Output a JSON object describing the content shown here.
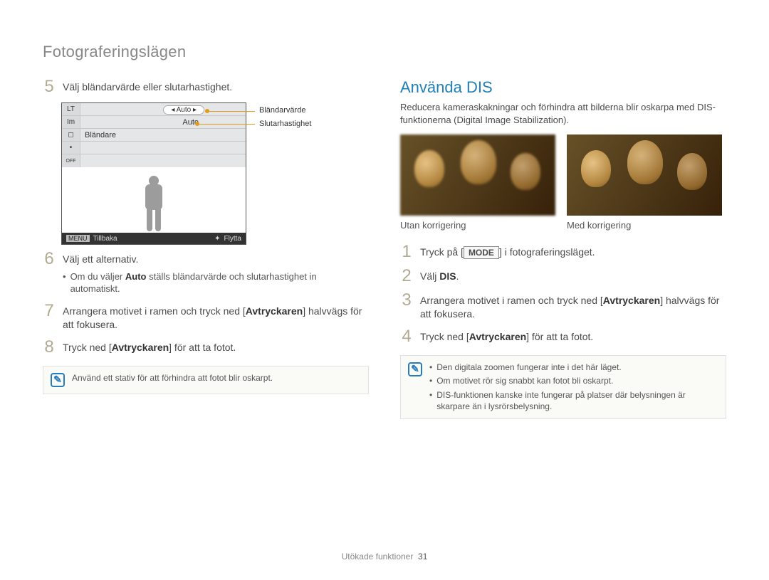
{
  "section_title": "Fotograferingslägen",
  "left": {
    "step5": {
      "num": "5",
      "text": "Välj bländarvärde eller slutarhastighet."
    },
    "lcd": {
      "row1_icon": "LT",
      "row1_value": "Auto",
      "row2_icon": "Im",
      "row2_value": "Auto",
      "row3_icon": "◻",
      "row3_label": "Bländare",
      "row4_icon": "•",
      "row5_icon": "OFF",
      "footer_menu": "MENU",
      "footer_back": "Tillbaka",
      "footer_move": "Flytta"
    },
    "annot1": "Bländarvärde",
    "annot2": "Slutarhastighet",
    "step6": {
      "num": "6",
      "text": "Välj ett alternativ.",
      "sub_prefix": "Om du väljer ",
      "sub_bold": "Auto",
      "sub_suffix": " ställs bländarvärde och slutarhastighet in automatiskt."
    },
    "step7": {
      "num": "7",
      "pre": "Arrangera motivet i ramen och tryck ned [",
      "bold": "Avtryckaren",
      "post": "] halvvägs för att fokusera."
    },
    "step8": {
      "num": "8",
      "pre": "Tryck ned [",
      "bold": "Avtryckaren",
      "post": "] för att ta fotot."
    },
    "tip": "Använd ett stativ för att förhindra att fotot blir oskarpt."
  },
  "right": {
    "title": "Använda DIS",
    "desc": "Reducera kameraskakningar och förhindra att bilderna blir oskarpa med DIS-funktionerna (Digital Image Stabilization).",
    "caption_a": "Utan korrigering",
    "caption_b": "Med korrigering",
    "step1": {
      "num": "1",
      "pre": "Tryck på [",
      "key": "MODE",
      "post": "] i fotograferingsläget."
    },
    "step2": {
      "num": "2",
      "pre": "Välj ",
      "bold": "DIS",
      "post": "."
    },
    "step3": {
      "num": "3",
      "pre": "Arrangera motivet i ramen och tryck ned [",
      "bold": "Avtryckaren",
      "post": "] halvvägs för att fokusera."
    },
    "step4": {
      "num": "4",
      "pre": "Tryck ned [",
      "bold": "Avtryckaren",
      "post": "] för att ta fotot."
    },
    "tips": [
      "Den digitala zoomen fungerar inte i det här läget.",
      "Om motivet rör sig snabbt kan fotot bli oskarpt.",
      "DIS-funktionen kanske inte fungerar på platser där belysningen är skarpare än i lysrörsbelysning."
    ]
  },
  "footer": {
    "label": "Utökade funktioner",
    "page": "31"
  }
}
